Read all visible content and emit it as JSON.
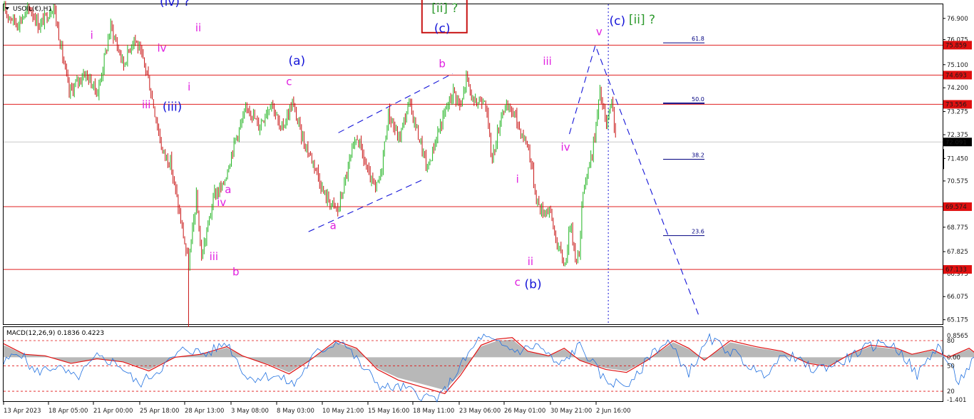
{
  "header": {
    "symbol_label": "USOIL(€),H1"
  },
  "colors": {
    "hline": "#e02020",
    "bull": "#22b422",
    "bear": "#c81414",
    "blue": "#1515d8",
    "magenta": "#e020e0",
    "green": "#2e9a2e",
    "fib": "#000080",
    "macd_hist": "#b8b8b8",
    "macd_signal": "#e01010",
    "macd_line": "#2070e0",
    "price_tag": "#e01010"
  },
  "chart_data": [
    {
      "type": "candlestick",
      "symbol": "USOIL(€)",
      "timeframe": "H1",
      "y_ticks": [
        "76.900",
        "76.075",
        "75.100",
        "74.200",
        "73.275",
        "72.375",
        "71.450",
        "70.575",
        "69.650",
        "68.775",
        "67.825",
        "66.975",
        "66.075",
        "65.175"
      ],
      "y_tick_values": [
        76.9,
        76.075,
        75.1,
        74.2,
        73.275,
        72.375,
        71.45,
        70.575,
        69.65,
        68.775,
        67.825,
        66.975,
        66.075,
        65.175
      ],
      "ylim": [
        65.0,
        77.45
      ],
      "x_ticks": [
        "13 Apr 2023",
        "18 Apr 05:00",
        "21 Apr 00:00",
        "25 Apr 18:00",
        "28 Apr 13:00",
        "3 May 08:00",
        "8 May 03:00",
        "10 May 21:00",
        "15 May 16:00",
        "18 May 11:00",
        "23 May 06:00",
        "26 May 01:00",
        "30 May 21:00",
        "2 Jun 16:00"
      ],
      "price_path": [
        [
          0,
          77.2
        ],
        [
          10,
          76.7
        ],
        [
          20,
          77.3
        ],
        [
          27,
          76.6
        ],
        [
          38,
          77.4
        ],
        [
          50,
          74.0
        ],
        [
          62,
          74.8
        ],
        [
          72,
          74.0
        ],
        [
          82,
          76.6
        ],
        [
          92,
          75.1
        ],
        [
          100,
          76.2
        ],
        [
          110,
          74.8
        ],
        [
          122,
          71.7
        ],
        [
          128,
          71.3
        ],
        [
          142,
          67.3
        ],
        [
          148,
          69.9
        ],
        [
          152,
          67.6
        ],
        [
          162,
          70.1
        ],
        [
          168,
          70.3
        ],
        [
          178,
          72.2
        ],
        [
          188,
          73.5
        ],
        [
          196,
          72.7
        ],
        [
          206,
          73.7
        ],
        [
          213,
          72.5
        ],
        [
          222,
          73.6
        ],
        [
          230,
          72.2
        ],
        [
          240,
          71.1
        ],
        [
          246,
          70.1
        ],
        [
          252,
          69.7
        ],
        [
          257,
          69.4
        ],
        [
          266,
          71.3
        ],
        [
          272,
          72.3
        ],
        [
          280,
          70.9
        ],
        [
          286,
          70.2
        ],
        [
          290,
          70.8
        ],
        [
          296,
          73.2
        ],
        [
          304,
          72.2
        ],
        [
          312,
          73.6
        ],
        [
          320,
          72.2
        ],
        [
          326,
          71.0
        ],
        [
          333,
          72.3
        ],
        [
          340,
          73.3
        ],
        [
          346,
          74.1
        ],
        [
          352,
          73.4
        ],
        [
          356,
          74.65
        ],
        [
          362,
          73.5
        ],
        [
          370,
          73.9
        ],
        [
          376,
          71.4
        ],
        [
          384,
          73.4
        ],
        [
          392,
          73.3
        ],
        [
          398,
          72.5
        ],
        [
          404,
          71.9
        ],
        [
          410,
          69.9
        ],
        [
          414,
          69.4
        ],
        [
          420,
          69.5
        ],
        [
          426,
          68.1
        ],
        [
          432,
          67.3
        ],
        [
          436,
          68.9
        ],
        [
          440,
          67.7
        ],
        [
          443,
          67.6
        ],
        [
          446,
          70.3
        ],
        [
          452,
          71.4
        ],
        [
          456,
          72.7
        ],
        [
          459,
          74.05
        ],
        [
          464,
          72.7
        ],
        [
          468,
          73.55
        ],
        [
          472,
          72.1
        ]
      ],
      "lows_marked": [
        [
          142,
          66.0
        ]
      ],
      "horizontal_levels": [
        {
          "value": 75.859,
          "label": "75.859"
        },
        {
          "value": 74.693,
          "label": "74.693"
        },
        {
          "value": 73.556,
          "label": "73.556"
        },
        {
          "value": 69.574,
          "label": "69.574"
        },
        {
          "value": 67.133,
          "label": "67.133"
        }
      ],
      "current_price": {
        "value": 72.091,
        "label": "72.091"
      },
      "fib_levels": [
        {
          "label": "61.8",
          "value": 75.95
        },
        {
          "label": "50.0",
          "value": 73.6
        },
        {
          "label": "38.2",
          "value": 71.42
        },
        {
          "label": "23.6",
          "value": 68.45
        }
      ],
      "wave_labels": [
        {
          "text": "(iv) ?",
          "color": "blue",
          "x": 132,
          "y": 77.4
        },
        {
          "text": "i",
          "color": "magenta",
          "x": 68,
          "y": 76.1
        },
        {
          "text": "iv",
          "color": "magenta",
          "x": 122,
          "y": 75.6
        },
        {
          "text": "ii",
          "color": "magenta",
          "x": 150,
          "y": 76.4
        },
        {
          "text": "i",
          "color": "magenta",
          "x": 143,
          "y": 74.1
        },
        {
          "text": "iii",
          "color": "magenta",
          "x": 110,
          "y": 73.4
        },
        {
          "text": "(iii)",
          "color": "blue",
          "x": 130,
          "y": 73.3
        },
        {
          "text": "(a)",
          "color": "blue",
          "x": 226,
          "y": 75.1
        },
        {
          "text": "c",
          "color": "magenta",
          "x": 220,
          "y": 74.3
        },
        {
          "text": "a",
          "color": "magenta",
          "x": 173,
          "y": 70.1
        },
        {
          "text": "iv",
          "color": "magenta",
          "x": 168,
          "y": 69.6
        },
        {
          "text": "iii",
          "color": "magenta",
          "x": 162,
          "y": 67.5
        },
        {
          "text": "b",
          "color": "magenta",
          "x": 179,
          "y": 66.9
        },
        {
          "text": "a",
          "color": "magenta",
          "x": 254,
          "y": 68.7
        },
        {
          "text": "b",
          "color": "magenta",
          "x": 338,
          "y": 75.0
        },
        {
          "text": "[ii] ?",
          "color": "green",
          "x": 340,
          "y": 77.15
        },
        {
          "text": "(c)",
          "color": "blue",
          "x": 338,
          "y": 76.35
        },
        {
          "text": "iii",
          "color": "magenta",
          "x": 419,
          "y": 75.1
        },
        {
          "text": "iv",
          "color": "magenta",
          "x": 433,
          "y": 71.75
        },
        {
          "text": "v",
          "color": "magenta",
          "x": 459,
          "y": 76.25
        },
        {
          "text": "(c)",
          "color": "blue",
          "x": 473,
          "y": 76.65
        },
        {
          "text": "[ii] ?",
          "color": "green",
          "x": 492,
          "y": 76.7
        },
        {
          "text": "i",
          "color": "magenta",
          "x": 396,
          "y": 70.5
        },
        {
          "text": "ii",
          "color": "magenta",
          "x": 406,
          "y": 67.3
        },
        {
          "text": "c",
          "color": "magenta",
          "x": 396,
          "y": 66.5
        },
        {
          "text": "(b)",
          "color": "blue",
          "x": 408,
          "y": 66.4
        }
      ],
      "trendlines": [
        {
          "from": [
            258,
            72.45
          ],
          "to": [
            346,
            74.75
          ]
        },
        {
          "from": [
            235,
            68.6
          ],
          "to": [
            322,
            70.6
          ]
        }
      ],
      "projection": [
        [
          436,
          72.4
        ],
        [
          456,
          75.85
        ],
        [
          536,
          65.3
        ]
      ],
      "vertical_marker_x": 466
    },
    {
      "type": "macd",
      "title": "MACD(12,26,9) 0.1836 0.4223",
      "params": "12,26,9",
      "macd": 0.1836,
      "signal": 0.4223,
      "y_ticks": [
        "0.8565",
        "80",
        "0.00",
        "50",
        "20",
        "-1.401"
      ],
      "levels": [
        80,
        50,
        20
      ],
      "signal_path": [
        [
          0,
          0.45
        ],
        [
          8,
          0.1
        ],
        [
          16,
          0.05
        ],
        [
          26,
          -0.2
        ],
        [
          36,
          -0.05
        ],
        [
          46,
          -0.15
        ],
        [
          56,
          -0.45
        ],
        [
          66,
          0.0
        ],
        [
          76,
          0.1
        ],
        [
          86,
          0.35
        ],
        [
          92,
          0.05
        ],
        [
          102,
          -0.25
        ],
        [
          110,
          -0.55
        ],
        [
          118,
          -0.1
        ],
        [
          128,
          0.55
        ],
        [
          136,
          0.3
        ],
        [
          144,
          -0.4
        ],
        [
          152,
          -0.75
        ],
        [
          160,
          -0.95
        ],
        [
          170,
          -1.2
        ],
        [
          176,
          -0.6
        ],
        [
          184,
          0.4
        ],
        [
          190,
          0.6
        ],
        [
          196,
          0.65
        ],
        [
          202,
          0.2
        ],
        [
          210,
          0.05
        ],
        [
          216,
          0.3
        ],
        [
          222,
          -0.1
        ],
        [
          232,
          -0.4
        ],
        [
          240,
          -0.5
        ],
        [
          248,
          -0.1
        ],
        [
          258,
          0.55
        ],
        [
          264,
          0.3
        ],
        [
          270,
          -0.1
        ],
        [
          280,
          0.55
        ],
        [
          290,
          0.35
        ],
        [
          300,
          0.2
        ],
        [
          310,
          -0.2
        ],
        [
          318,
          -0.3
        ],
        [
          326,
          0.1
        ],
        [
          334,
          0.4
        ],
        [
          344,
          0.3
        ],
        [
          350,
          0.1
        ],
        [
          358,
          0.25
        ],
        [
          364,
          0.0
        ],
        [
          372,
          0.3
        ],
        [
          378,
          -0.1
        ],
        [
          384,
          -0.6
        ],
        [
          390,
          -0.9
        ],
        [
          398,
          -0.5
        ],
        [
          406,
          -0.3
        ],
        [
          412,
          0.25
        ],
        [
          418,
          0.55
        ],
        [
          426,
          0.7
        ],
        [
          432,
          0.5
        ]
      ],
      "macd_path": [
        [
          0,
          -0.2
        ],
        [
          6,
          0.2
        ],
        [
          12,
          -0.5
        ],
        [
          20,
          -0.3
        ],
        [
          28,
          -0.7
        ],
        [
          36,
          0.0
        ],
        [
          44,
          -0.2
        ],
        [
          52,
          -0.9
        ],
        [
          60,
          -0.4
        ],
        [
          70,
          0.3
        ],
        [
          78,
          0.1
        ],
        [
          86,
          0.5
        ],
        [
          94,
          -0.7
        ],
        [
          104,
          -0.6
        ],
        [
          112,
          -0.9
        ],
        [
          120,
          0.1
        ],
        [
          130,
          0.6
        ],
        [
          138,
          -0.3
        ],
        [
          146,
          -1.0
        ],
        [
          154,
          -1.0
        ],
        [
          162,
          -1.3
        ],
        [
          168,
          -1.35
        ],
        [
          176,
          -0.3
        ],
        [
          184,
          0.7
        ],
        [
          190,
          0.45
        ],
        [
          198,
          0.2
        ],
        [
          206,
          0.4
        ],
        [
          214,
          -0.3
        ],
        [
          222,
          0.4
        ],
        [
          232,
          -0.8
        ],
        [
          242,
          -0.9
        ],
        [
          250,
          0.2
        ],
        [
          256,
          0.5
        ],
        [
          264,
          -0.5
        ],
        [
          272,
          0.6
        ],
        [
          282,
          0.1
        ],
        [
          292,
          -0.6
        ],
        [
          302,
          0.1
        ],
        [
          312,
          -0.4
        ],
        [
          322,
          -0.2
        ],
        [
          332,
          0.3
        ],
        [
          340,
          0.5
        ],
        [
          346,
          0.15
        ],
        [
          352,
          -0.6
        ],
        [
          360,
          0.4
        ],
        [
          368,
          -0.8
        ],
        [
          376,
          0.15
        ],
        [
          384,
          -0.9
        ],
        [
          392,
          -1.1
        ],
        [
          400,
          -0.8
        ],
        [
          410,
          0.2
        ],
        [
          418,
          0.7
        ],
        [
          426,
          0.65
        ],
        [
          432,
          0.18
        ]
      ]
    }
  ],
  "xlabels_note": ""
}
